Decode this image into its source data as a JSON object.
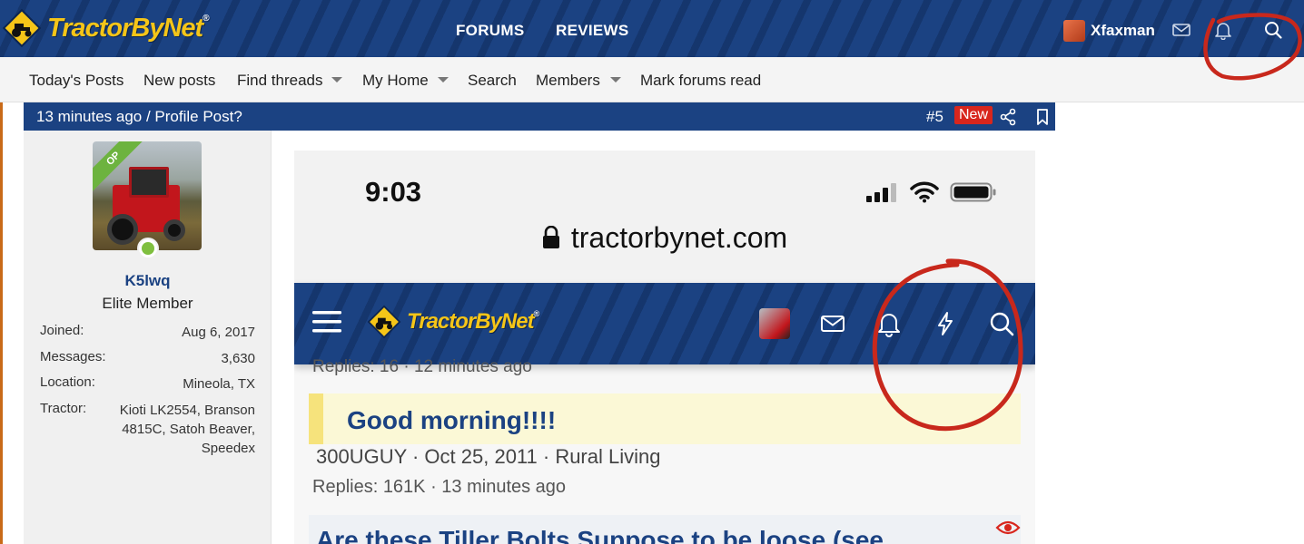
{
  "header": {
    "logo_text": "TractorByNet",
    "logo_mark": "®",
    "tabs": [
      "FORUMS",
      "REVIEWS"
    ],
    "username": "Xfaxman",
    "icons": [
      "envelope-icon",
      "bell-icon",
      "search-icon"
    ]
  },
  "subnav": {
    "items": [
      "Today's Posts",
      "New posts",
      "Find threads",
      "My Home",
      "Search",
      "Members",
      "Mark forums read"
    ]
  },
  "post": {
    "title": "13 minutes ago / Profile Post?",
    "number": "#5",
    "badge": "New",
    "icons": [
      "share-icon",
      "bookmark-icon"
    ]
  },
  "author": {
    "ribbon": "OP",
    "name": "K5lwq",
    "title": "Elite Member",
    "info": [
      {
        "label": "Joined:",
        "value": "Aug 6, 2017"
      },
      {
        "label": "Messages:",
        "value": "3,630"
      },
      {
        "label": "Location:",
        "value": "Mineola, TX"
      },
      {
        "label": "Tractor:",
        "value": "Kioti LK2554, Branson 4815C, Satoh Beaver, Speedex"
      }
    ]
  },
  "screenshot": {
    "time": "9:03",
    "url": "tractorbynet.com",
    "logo_text": "TractorByNet",
    "logo_mark": "®",
    "faded_row": "Replies: 16 · 12 minutes ago",
    "thread1": {
      "title": "Good morning!!!!",
      "meta": "300UGUY · Oct 25, 2011 · Rural Living",
      "stats": "Replies: 161K · 13 minutes ago"
    },
    "thread2": {
      "title": "Are these Tiller Bolts Suppose to be loose (see"
    }
  },
  "colors": {
    "brand_blue": "#1b4282",
    "logo_yellow": "#f5c518",
    "new_badge": "#d8261d",
    "annotation_red": "#c8281c"
  }
}
